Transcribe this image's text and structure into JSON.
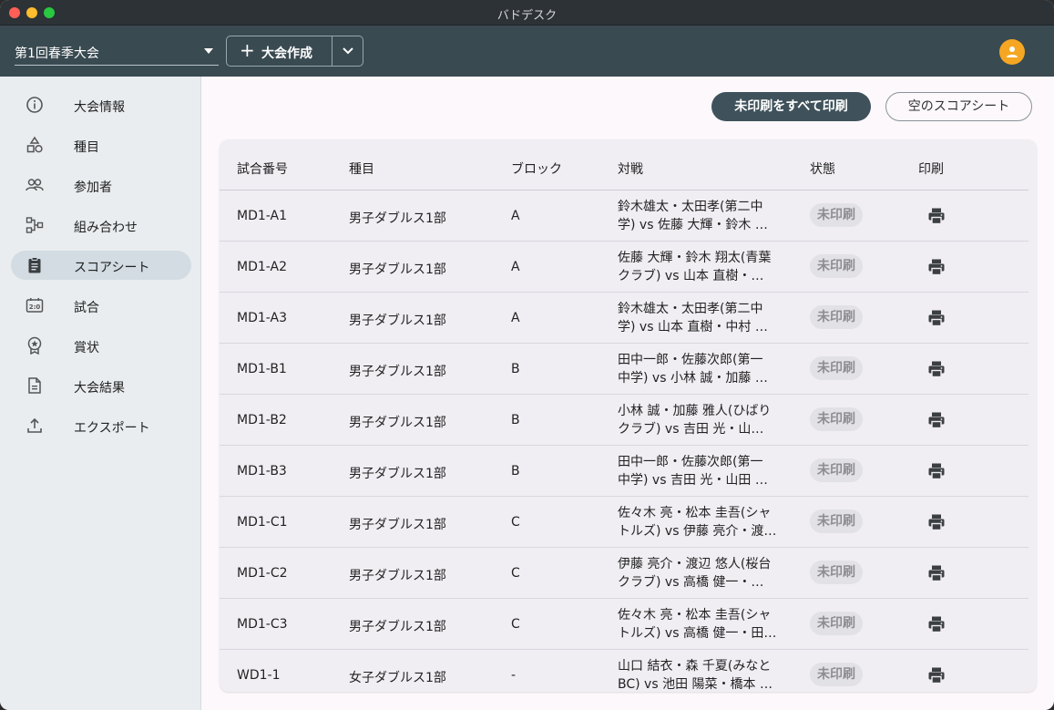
{
  "window": {
    "title": "バドデスク"
  },
  "appbar": {
    "tournament_select": "第1回春季大会",
    "create_label": "大会作成",
    "create_plus": "+"
  },
  "sidebar": {
    "items": [
      {
        "label": "大会情報",
        "icon": "info-icon"
      },
      {
        "label": "種目",
        "icon": "shapes-icon"
      },
      {
        "label": "参加者",
        "icon": "people-icon"
      },
      {
        "label": "組み合わせ",
        "icon": "bracket-icon"
      },
      {
        "label": "スコアシート",
        "icon": "clipboard-icon",
        "active": true
      },
      {
        "label": "試合",
        "icon": "scoreboard-icon"
      },
      {
        "label": "賞状",
        "icon": "award-icon"
      },
      {
        "label": "大会結果",
        "icon": "document-icon"
      },
      {
        "label": "エクスポート",
        "icon": "export-icon"
      }
    ]
  },
  "actions": {
    "print_all": "未印刷をすべて印刷",
    "blank_sheet": "空のスコアシート"
  },
  "table": {
    "headers": {
      "id": "試合番号",
      "event": "種目",
      "block": "ブロック",
      "match": "対戦",
      "status": "状態",
      "print": "印刷"
    },
    "rows": [
      {
        "id": "MD1-A1",
        "event": "男子ダブルス1部",
        "block": "A",
        "match1": "鈴木雄太・太田孝(第二中",
        "match2": "学) vs 佐藤 大輝・鈴木 …",
        "status": "未印刷"
      },
      {
        "id": "MD1-A2",
        "event": "男子ダブルス1部",
        "block": "A",
        "match1": "佐藤 大輝・鈴木 翔太(青葉",
        "match2": "クラブ) vs 山本 直樹・…",
        "status": "未印刷"
      },
      {
        "id": "MD1-A3",
        "event": "男子ダブルス1部",
        "block": "A",
        "match1": "鈴木雄太・太田孝(第二中",
        "match2": "学) vs 山本 直樹・中村 …",
        "status": "未印刷"
      },
      {
        "id": "MD1-B1",
        "event": "男子ダブルス1部",
        "block": "B",
        "match1": "田中一郎・佐藤次郎(第一",
        "match2": "中学) vs 小林 誠・加藤 …",
        "status": "未印刷"
      },
      {
        "id": "MD1-B2",
        "event": "男子ダブルス1部",
        "block": "B",
        "match1": "小林 誠・加藤 雅人(ひばり",
        "match2": "クラブ) vs 吉田 光・山…",
        "status": "未印刷"
      },
      {
        "id": "MD1-B3",
        "event": "男子ダブルス1部",
        "block": "B",
        "match1": "田中一郎・佐藤次郎(第一",
        "match2": "中学) vs 吉田 光・山田 …",
        "status": "未印刷"
      },
      {
        "id": "MD1-C1",
        "event": "男子ダブルス1部",
        "block": "C",
        "match1": "佐々木 亮・松本 圭吾(シャ",
        "match2": "トルズ) vs 伊藤 亮介・渡…",
        "status": "未印刷"
      },
      {
        "id": "MD1-C2",
        "event": "男子ダブルス1部",
        "block": "C",
        "match1": "伊藤 亮介・渡辺 悠人(桜台",
        "match2": "クラブ) vs 高橋 健一・…",
        "status": "未印刷"
      },
      {
        "id": "MD1-C3",
        "event": "男子ダブルス1部",
        "block": "C",
        "match1": "佐々木 亮・松本 圭吾(シャ",
        "match2": "トルズ) vs 高橋 健一・田…",
        "status": "未印刷"
      },
      {
        "id": "WD1-1",
        "event": "女子ダブルス1部",
        "block": "-",
        "match1": "山口 結衣・森 千夏(みなと",
        "match2": "BC) vs 池田 陽菜・橋本 …",
        "status": "未印刷"
      }
    ]
  }
}
